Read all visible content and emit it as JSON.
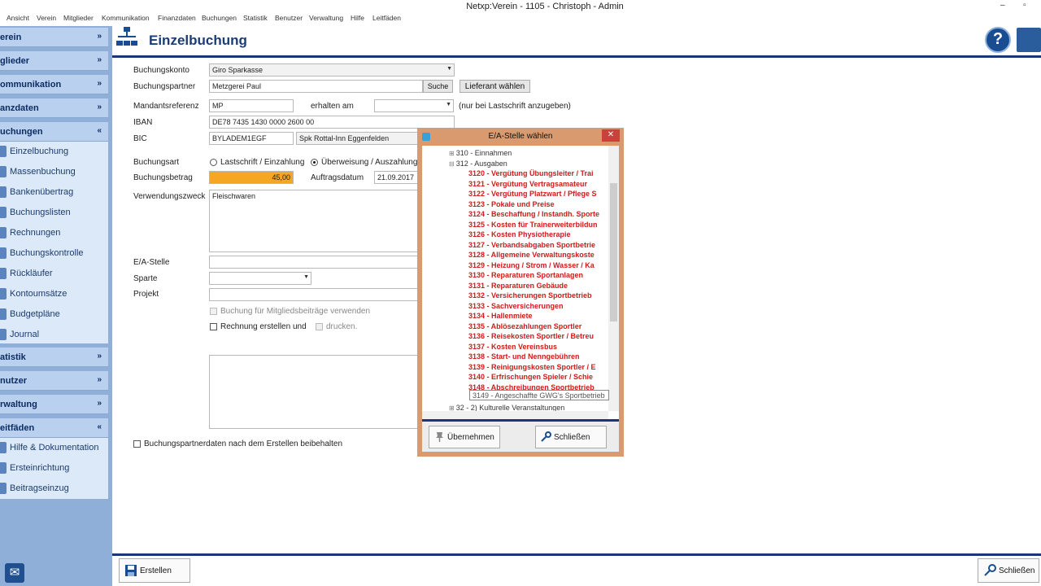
{
  "window": {
    "title": "Netxp:Verein - 1105 - Christoph - Admin",
    "controls": [
      "–",
      "▫",
      "✕"
    ]
  },
  "menubar": [
    "Ansicht",
    "Verein",
    "Mitglieder",
    "Kommunikation",
    "Finanzdaten",
    "Buchungen",
    "Statistik",
    "Benutzer",
    "Verwaltung",
    "Hilfe",
    "Leitfäden"
  ],
  "sidebar": {
    "sections": [
      {
        "label": "erein",
        "chevron": "»"
      },
      {
        "label": "glieder",
        "chevron": "»"
      },
      {
        "label": "ommunikation",
        "chevron": "»"
      },
      {
        "label": "anzdaten",
        "chevron": "»"
      },
      {
        "label": "uchungen",
        "chevron": "«"
      },
      {
        "label": "atistik",
        "chevron": "»"
      },
      {
        "label": "nutzer",
        "chevron": "»"
      },
      {
        "label": "rwaltung",
        "chevron": "»"
      },
      {
        "label": "eitfäden",
        "chevron": "«"
      }
    ],
    "buchungen_items": [
      "Einzelbuchung",
      "Massenbuchung",
      "Bankenübertrag",
      "Buchungslisten",
      "Rechnungen",
      "Buchungskontrolle",
      "Rückläufer",
      "Kontoumsätze",
      "Budgetpläne",
      "Journal"
    ],
    "leitfaeden_items": [
      "Hilfe & Dokumentation",
      "Ersteinrichtung",
      "Beitragseinzug"
    ]
  },
  "header": {
    "title": "Einzelbuchung",
    "help_label": "?"
  },
  "form": {
    "buchungskonto": {
      "label": "Buchungskonto",
      "value": "Giro Sparkasse"
    },
    "buchungspartner": {
      "label": "Buchungspartner",
      "value": "Metzgerei Paul",
      "search_label": "Suche",
      "supplier_label": "Lieferant wählen"
    },
    "mandatsreferenz": {
      "label": "Mandantsreferenz",
      "value": "MP",
      "erhalten_label": "erhalten am",
      "erhalten_value": "",
      "hint": "(nur bei Lastschrift anzugeben)"
    },
    "iban": {
      "label": "IBAN",
      "value": "DE78 7435 1430 0000 2600 00"
    },
    "bic": {
      "label": "BIC",
      "value": "BYLADEM1EGF",
      "bank": "Spk Rottal-Inn Eggenfelden"
    },
    "buchungsart": {
      "label": "Buchungsart",
      "option1": "Lastschrift / Einzahlung",
      "option2": "Überweisung / Auszahlung",
      "selected": "option2"
    },
    "buchungsbetrag": {
      "label": "Buchungsbetrag",
      "value": "45,00",
      "highlight": "#f5a623",
      "auftragsdatum_label": "Auftragsdatum",
      "auftragsdatum_value": "21.09.2017"
    },
    "verwendungszweck": {
      "label": "Verwendungszweck",
      "value": "Fleischwaren"
    },
    "ea_stelle": {
      "label": "E/A-Stelle",
      "value": ""
    },
    "sparte": {
      "label": "Sparte",
      "value": ""
    },
    "projekt": {
      "label": "Projekt",
      "value": ""
    },
    "mitgliedsbeitraege": {
      "label": "Buchung für Mitgliedsbeiträge verwenden",
      "checked": false,
      "disabled": true
    },
    "rechnung": {
      "label": "Rechnung erstellen und",
      "checked": false,
      "drucken_label": "drucken."
    },
    "beibehalten": {
      "label": "Buchungspartnerdaten nach dem Erstellen beibehalten",
      "checked": false
    }
  },
  "footer": {
    "create_label": "Erstellen",
    "close_label": "Schließen"
  },
  "dialog": {
    "title": "E/A-Stelle wählen",
    "close_glyph": "✕",
    "tree": [
      {
        "text": "310 - Einnahmen",
        "kind": "grey",
        "expander": "⊞"
      },
      {
        "text": "312 - Ausgaben",
        "kind": "grey",
        "expander": "⊟"
      },
      {
        "text": "3120 - Vergütung Übungsleiter / Trai",
        "kind": "red"
      },
      {
        "text": "3121 - Vergütung Vertragsamateur",
        "kind": "red"
      },
      {
        "text": "3122 - Vergütung Platzwart / Pflege S",
        "kind": "red"
      },
      {
        "text": "3123 - Pokale und Preise",
        "kind": "red"
      },
      {
        "text": "3124 - Beschaffung / Instandh. Sporte",
        "kind": "red"
      },
      {
        "text": "3125 - Kosten für Trainerweiterbildun",
        "kind": "red"
      },
      {
        "text": "3126 - Kosten Physiotherapie",
        "kind": "red"
      },
      {
        "text": "3127 - Verbandsabgaben Sportbetrie",
        "kind": "red"
      },
      {
        "text": "3128 - Allgemeine Verwaltungskoste",
        "kind": "red"
      },
      {
        "text": "3129 - Heizung / Strom / Wasser / Ka",
        "kind": "red"
      },
      {
        "text": "3130 - Reparaturen Sportanlagen",
        "kind": "red"
      },
      {
        "text": "3131 - Reparaturen Gebäude",
        "kind": "red"
      },
      {
        "text": "3132 - Versicherungen Sportbetrieb",
        "kind": "red"
      },
      {
        "text": "3133 - Sachversicherungen",
        "kind": "red"
      },
      {
        "text": "3134 - Hallenmiete",
        "kind": "red"
      },
      {
        "text": "3135 - Ablösezahlungen Sportler",
        "kind": "red"
      },
      {
        "text": "3136 - Reisekosten Sportler / Betreu",
        "kind": "red"
      },
      {
        "text": "3137 - Kosten Vereinsbus",
        "kind": "red"
      },
      {
        "text": "3138 - Start- und Nenngebühren",
        "kind": "red"
      },
      {
        "text": "3139 - Reinigungskosten Sportler / E",
        "kind": "red"
      },
      {
        "text": "3140 - Erfrischungen Spieler / Schie",
        "kind": "red"
      },
      {
        "text": "3148 - Abschreibungen Sportbetrieb",
        "kind": "red"
      },
      {
        "text": "",
        "kind": "spacer"
      },
      {
        "text": "32 - 2) Kulturelle Veranstaltungen",
        "kind": "grey",
        "expander": "⊞"
      }
    ],
    "tooltip": "3149 - Angeschaffte GWG's Sportbetrieb",
    "accept_label": "Übernehmen",
    "close_label": "Schließen"
  }
}
